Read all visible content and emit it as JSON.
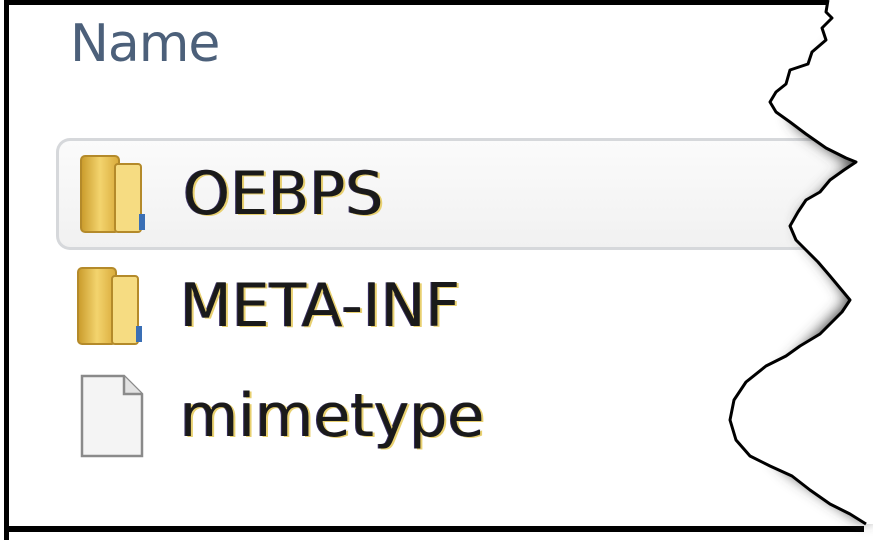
{
  "list": {
    "header": "Name",
    "items": [
      {
        "label": "OEBPS",
        "icon": "folder-icon",
        "selected": true
      },
      {
        "label": "META-INF",
        "icon": "folder-icon",
        "selected": false
      },
      {
        "label": "mimetype",
        "icon": "file-icon",
        "selected": false
      }
    ]
  },
  "colors": {
    "header_text": "#4c607a",
    "folder": "#f0cc5a",
    "selection_border": "#d6d8db"
  }
}
